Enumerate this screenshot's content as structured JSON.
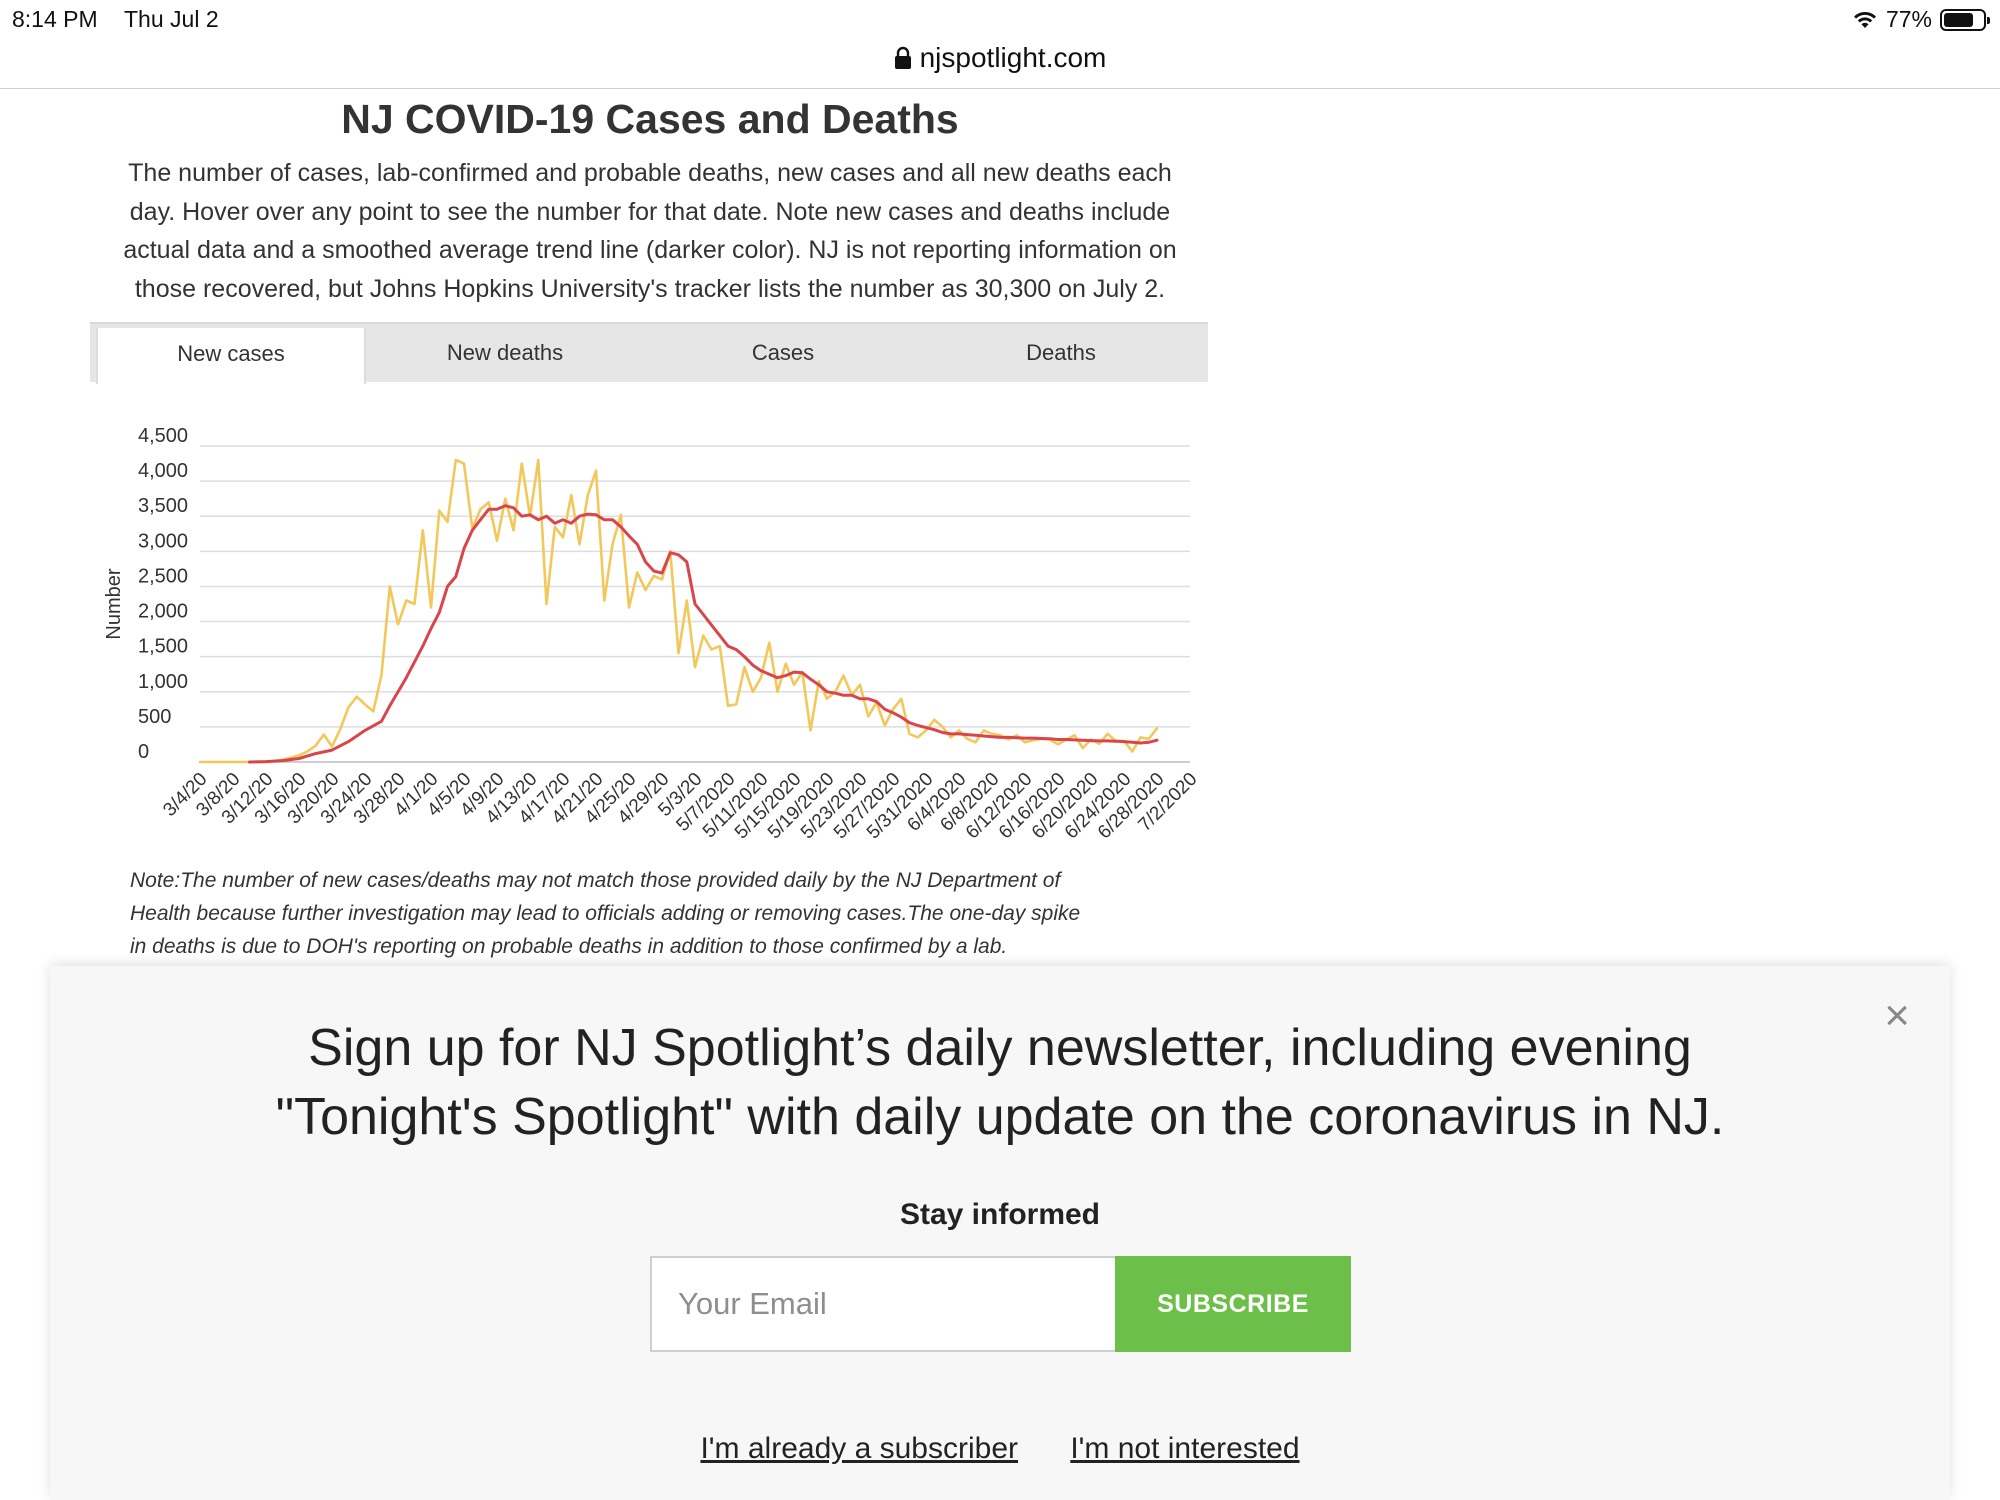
{
  "status_bar": {
    "time": "8:14 PM",
    "date": "Thu Jul 2",
    "battery": "77%"
  },
  "browser": {
    "domain": "njspotlight.com"
  },
  "article": {
    "title": "NJ COVID-19 Cases and Deaths",
    "description_lines": [
      "The number of cases, lab-confirmed and probable deaths, new cases and all new deaths each",
      "day. Hover over any point to see the number for that date. Note new cases and deaths include",
      "actual data and a smoothed average trend line (darker color). NJ is not reporting information on",
      "those recovered, but Johns Hopkins University's tracker lists the number as 30,300 on July 2."
    ],
    "tabs": [
      {
        "label": "New cases",
        "active": true
      },
      {
        "label": "New deaths",
        "active": false
      },
      {
        "label": "Cases",
        "active": false
      },
      {
        "label": "Deaths",
        "active": false
      }
    ],
    "note_lines": [
      "Note:The number of new cases/deaths may not match those provided daily by the NJ Department of",
      "Health because further investigation may lead to officials adding or removing cases.The one-day spike",
      "in deaths is due to DOH's reporting on probable deaths in addition to those confirmed by a lab."
    ]
  },
  "chart_data": {
    "type": "line",
    "ylabel": "Number",
    "ylim": [
      0,
      4500
    ],
    "yticks": [
      0,
      500,
      1000,
      1500,
      2000,
      2500,
      3000,
      3500,
      4000,
      4500
    ],
    "ytick_labels": [
      "0",
      "500",
      "1,000",
      "1,500",
      "2,000",
      "2,500",
      "3,000",
      "3,500",
      "4,000",
      "4,500"
    ],
    "grid": true,
    "x_tick_labels": [
      "3/4/20",
      "3/8/20",
      "3/12/20",
      "3/16/20",
      "3/20/20",
      "3/24/20",
      "3/28/20",
      "4/1/20",
      "4/5/20",
      "4/9/20",
      "4/13/20",
      "4/17/20",
      "4/21/20",
      "4/25/20",
      "4/29/20",
      "5/3/20",
      "5/7/2020",
      "5/11/2020",
      "5/15/2020",
      "5/19/2020",
      "5/23/2020",
      "5/27/2020",
      "5/31/2020",
      "6/4/2020",
      "6/8/2020",
      "6/12/2020",
      "6/16/2020",
      "6/20/2020",
      "6/24/2020",
      "6/28/2020",
      "7/2/2020"
    ],
    "x_range_days": [
      0,
      120
    ],
    "series": [
      {
        "color": "#f2c85b",
        "points": [
          [
            0,
            0
          ],
          [
            2,
            0
          ],
          [
            4,
            0
          ],
          [
            6,
            0
          ],
          [
            8,
            1
          ],
          [
            10,
            30
          ],
          [
            12,
            95
          ],
          [
            13,
            150
          ],
          [
            14,
            230
          ],
          [
            15,
            390
          ],
          [
            16,
            220
          ],
          [
            17,
            470
          ],
          [
            18,
            780
          ],
          [
            19,
            930
          ],
          [
            20,
            820
          ],
          [
            21,
            720
          ],
          [
            22,
            1240
          ],
          [
            23,
            2500
          ],
          [
            24,
            1960
          ],
          [
            25,
            2300
          ],
          [
            26,
            2250
          ],
          [
            27,
            3300
          ],
          [
            28,
            2200
          ],
          [
            29,
            3580
          ],
          [
            30,
            3420
          ],
          [
            31,
            4300
          ],
          [
            32,
            4250
          ],
          [
            33,
            3330
          ],
          [
            34,
            3600
          ],
          [
            35,
            3700
          ],
          [
            36,
            3150
          ],
          [
            37,
            3750
          ],
          [
            38,
            3300
          ],
          [
            39,
            4250
          ],
          [
            40,
            3500
          ],
          [
            41,
            4300
          ],
          [
            42,
            2250
          ],
          [
            43,
            3350
          ],
          [
            44,
            3200
          ],
          [
            45,
            3800
          ],
          [
            46,
            3100
          ],
          [
            47,
            3800
          ],
          [
            48,
            4150
          ],
          [
            49,
            2300
          ],
          [
            50,
            3100
          ],
          [
            51,
            3520
          ],
          [
            52,
            2200
          ],
          [
            53,
            2700
          ],
          [
            54,
            2450
          ],
          [
            55,
            2650
          ],
          [
            56,
            2600
          ],
          [
            57,
            3000
          ],
          [
            58,
            1550
          ],
          [
            59,
            2300
          ],
          [
            60,
            1350
          ],
          [
            61,
            1800
          ],
          [
            62,
            1600
          ],
          [
            63,
            1650
          ],
          [
            64,
            800
          ],
          [
            65,
            820
          ],
          [
            66,
            1350
          ],
          [
            67,
            1000
          ],
          [
            68,
            1200
          ],
          [
            69,
            1700
          ],
          [
            70,
            1000
          ],
          [
            71,
            1400
          ],
          [
            72,
            1100
          ],
          [
            73,
            1280
          ],
          [
            74,
            450
          ],
          [
            75,
            1150
          ],
          [
            76,
            900
          ],
          [
            77,
            1000
          ],
          [
            78,
            1230
          ],
          [
            79,
            950
          ],
          [
            80,
            1100
          ],
          [
            81,
            650
          ],
          [
            82,
            850
          ],
          [
            83,
            520
          ],
          [
            84,
            750
          ],
          [
            85,
            900
          ],
          [
            86,
            400
          ],
          [
            87,
            350
          ],
          [
            88,
            450
          ],
          [
            89,
            600
          ],
          [
            90,
            500
          ],
          [
            91,
            350
          ],
          [
            92,
            450
          ],
          [
            93,
            330
          ],
          [
            94,
            280
          ],
          [
            95,
            450
          ],
          [
            96,
            400
          ],
          [
            97,
            380
          ],
          [
            98,
            320
          ],
          [
            99,
            380
          ],
          [
            100,
            280
          ],
          [
            101,
            310
          ],
          [
            102,
            330
          ],
          [
            103,
            320
          ],
          [
            104,
            250
          ],
          [
            105,
            320
          ],
          [
            106,
            380
          ],
          [
            107,
            200
          ],
          [
            108,
            320
          ],
          [
            109,
            260
          ],
          [
            110,
            400
          ],
          [
            111,
            300
          ],
          [
            112,
            300
          ],
          [
            113,
            150
          ],
          [
            114,
            350
          ],
          [
            115,
            330
          ],
          [
            116,
            480
          ]
        ]
      },
      {
        "color": "#d9454a",
        "points": [
          [
            6,
            0
          ],
          [
            8,
            5
          ],
          [
            10,
            20
          ],
          [
            12,
            50
          ],
          [
            14,
            120
          ],
          [
            16,
            170
          ],
          [
            18,
            290
          ],
          [
            20,
            450
          ],
          [
            22,
            580
          ],
          [
            23,
            800
          ],
          [
            25,
            1200
          ],
          [
            27,
            1650
          ],
          [
            28,
            1900
          ],
          [
            29,
            2130
          ],
          [
            30,
            2500
          ],
          [
            31,
            2640
          ],
          [
            32,
            3040
          ],
          [
            33,
            3300
          ],
          [
            34,
            3450
          ],
          [
            35,
            3600
          ],
          [
            36,
            3600
          ],
          [
            37,
            3650
          ],
          [
            38,
            3620
          ],
          [
            39,
            3500
          ],
          [
            40,
            3520
          ],
          [
            41,
            3450
          ],
          [
            42,
            3500
          ],
          [
            43,
            3400
          ],
          [
            44,
            3450
          ],
          [
            45,
            3400
          ],
          [
            46,
            3500
          ],
          [
            47,
            3530
          ],
          [
            48,
            3520
          ],
          [
            49,
            3450
          ],
          [
            50,
            3450
          ],
          [
            51,
            3350
          ],
          [
            52,
            3220
          ],
          [
            53,
            3100
          ],
          [
            54,
            2850
          ],
          [
            55,
            2720
          ],
          [
            56,
            2690
          ],
          [
            57,
            2980
          ],
          [
            58,
            2950
          ],
          [
            59,
            2850
          ],
          [
            60,
            2250
          ],
          [
            61,
            2100
          ],
          [
            62,
            1950
          ],
          [
            63,
            1800
          ],
          [
            64,
            1650
          ],
          [
            65,
            1600
          ],
          [
            66,
            1500
          ],
          [
            67,
            1380
          ],
          [
            68,
            1300
          ],
          [
            69,
            1250
          ],
          [
            70,
            1200
          ],
          [
            71,
            1230
          ],
          [
            72,
            1280
          ],
          [
            73,
            1270
          ],
          [
            74,
            1180
          ],
          [
            75,
            1100
          ],
          [
            76,
            1000
          ],
          [
            77,
            980
          ],
          [
            78,
            950
          ],
          [
            79,
            950
          ],
          [
            80,
            900
          ],
          [
            81,
            900
          ],
          [
            82,
            860
          ],
          [
            83,
            750
          ],
          [
            84,
            700
          ],
          [
            85,
            640
          ],
          [
            86,
            560
          ],
          [
            87,
            520
          ],
          [
            88,
            490
          ],
          [
            89,
            460
          ],
          [
            90,
            420
          ],
          [
            91,
            400
          ],
          [
            92,
            400
          ],
          [
            93,
            390
          ],
          [
            94,
            380
          ],
          [
            95,
            370
          ],
          [
            96,
            360
          ],
          [
            97,
            350
          ],
          [
            98,
            350
          ],
          [
            99,
            345
          ],
          [
            100,
            340
          ],
          [
            101,
            340
          ],
          [
            102,
            335
          ],
          [
            103,
            330
          ],
          [
            104,
            320
          ],
          [
            105,
            320
          ],
          [
            106,
            315
          ],
          [
            107,
            310
          ],
          [
            108,
            305
          ],
          [
            109,
            300
          ],
          [
            110,
            300
          ],
          [
            111,
            295
          ],
          [
            112,
            290
          ],
          [
            113,
            280
          ],
          [
            114,
            270
          ],
          [
            115,
            280
          ],
          [
            116,
            310
          ]
        ]
      }
    ]
  },
  "newsletter": {
    "headline_line1": "Sign up for NJ Spotlight’s daily newsletter, including evening",
    "headline_line2": "\"Tonight's Spotlight\" with daily update on the coronavirus in NJ.",
    "stay_label": "Stay informed",
    "email_placeholder": "Your Email",
    "subscribe_label": "SUBSCRIBE",
    "already_subscriber": "I'm already a subscriber",
    "not_interested": "I'm not interested",
    "close_glyph": "×"
  }
}
